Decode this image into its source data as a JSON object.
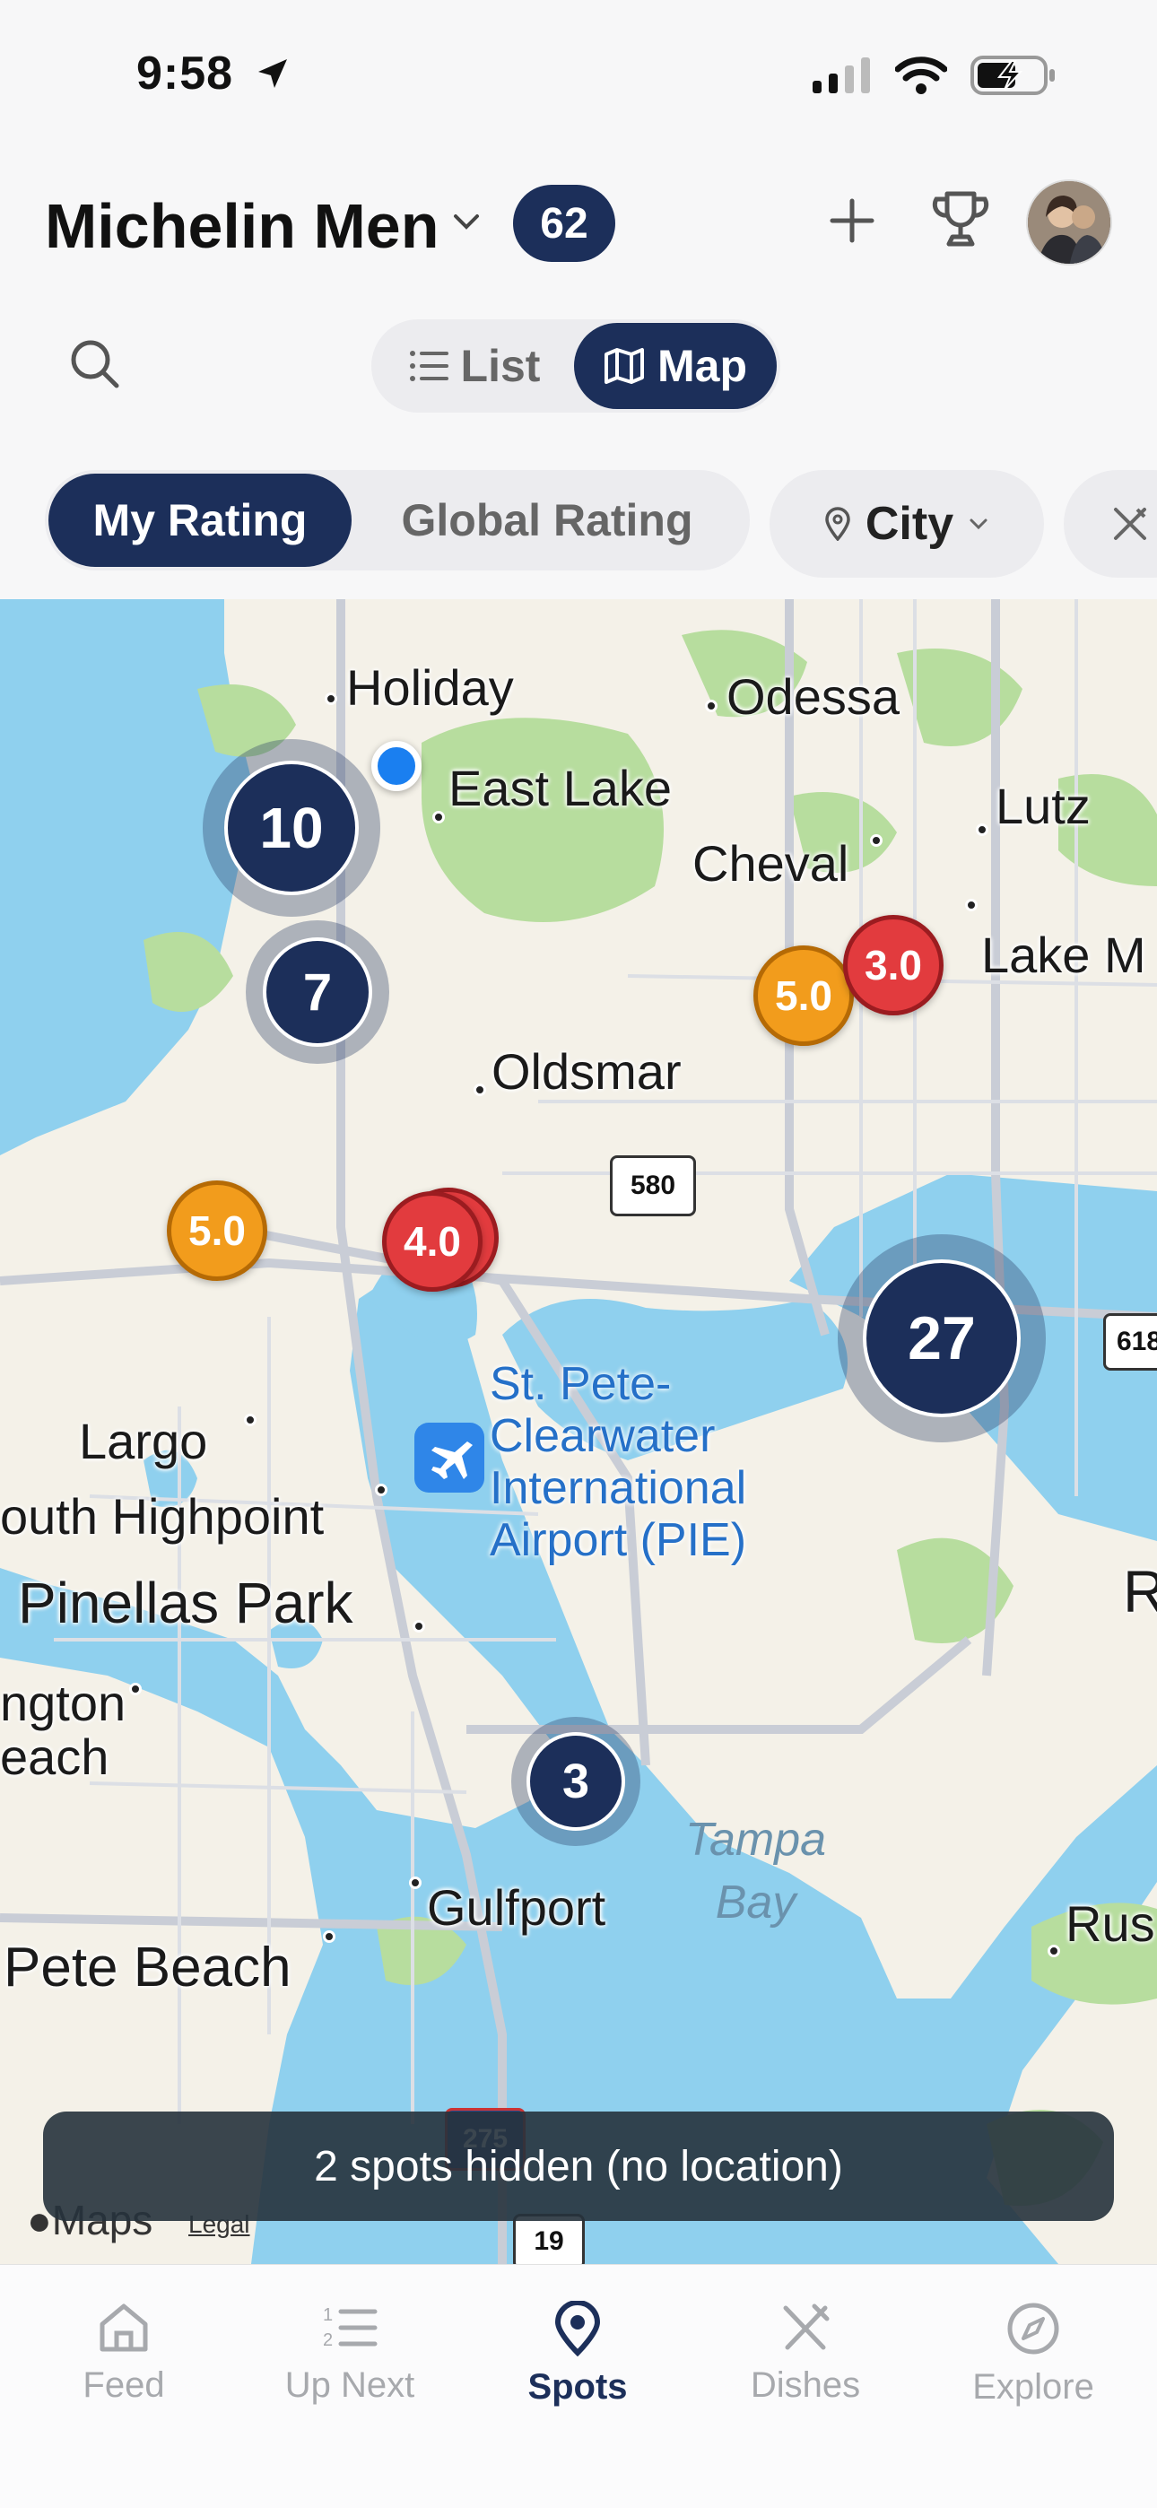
{
  "status_bar": {
    "time": "9:58"
  },
  "header": {
    "group_name": "Michelin Men",
    "member_count": "62"
  },
  "view_toggle": {
    "list_label": "List",
    "map_label": "Map",
    "selected": "Map"
  },
  "filters": {
    "my_rating": "My Rating",
    "global_rating": "Global Rating",
    "city": "City",
    "selected": "My Rating"
  },
  "map": {
    "places": {
      "holiday": "Holiday",
      "odessa": "Odessa",
      "east_lake": "East Lake",
      "lutz": "Lutz",
      "cheval": "Cheval",
      "lake_m": "Lake M",
      "oldsmar": "Oldsmar",
      "largo": "Largo",
      "south_highpoint": "outh Highpoint",
      "pinellas_park": "Pinellas Park",
      "ngton": "ngton",
      "each": "each",
      "gulfport": "Gulfport",
      "pete_beach": "Pete Beach",
      "rus": "Rus",
      "r": "R"
    },
    "airport": [
      "St. Pete-",
      "Clearwater",
      "International",
      "Airport (PIE)"
    ],
    "water": [
      "Tampa",
      "Bay"
    ],
    "road_shields": {
      "fl580": "580",
      "i275": "275",
      "us19": "19",
      "r618": "618"
    },
    "clusters": [
      {
        "count": "10"
      },
      {
        "count": "7"
      },
      {
        "count": "27"
      },
      {
        "count": "3"
      }
    ],
    "pins": [
      {
        "rating": "5.0",
        "color": "#f29c1c"
      },
      {
        "rating": "3.0",
        "color": "#e23b3e"
      },
      {
        "rating": "5.0",
        "color": "#f29c1c"
      },
      {
        "rating": "4.0",
        "color": "#e23b3e"
      }
    ],
    "hidden_notice": "2 spots hidden (no location)",
    "attribution": "Maps",
    "legal": "Legal"
  },
  "tabs": [
    {
      "label": "Feed",
      "icon": "home-icon"
    },
    {
      "label": "Up Next",
      "icon": "numbered-list-icon"
    },
    {
      "label": "Spots",
      "icon": "location-pin-icon"
    },
    {
      "label": "Dishes",
      "icon": "utensils-icon"
    },
    {
      "label": "Explore",
      "icon": "compass-icon"
    }
  ],
  "active_tab": "Spots",
  "colors": {
    "accent": "#1c2f5a",
    "map_water": "#8fd0ee",
    "map_land": "#f4f1e8",
    "map_park": "#b7dd9e"
  }
}
